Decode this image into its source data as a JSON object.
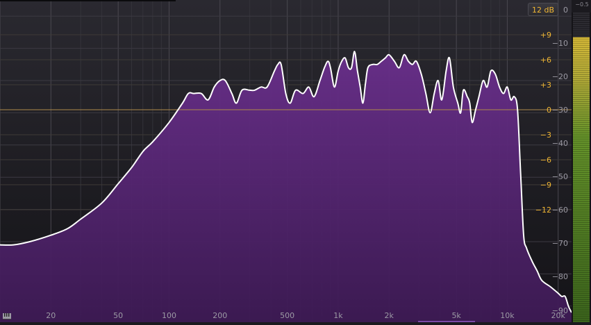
{
  "toolbar": {
    "range_label": "12 dB"
  },
  "meter": {
    "peak_label": "−0.5",
    "level_fraction": 0.92
  },
  "scale": {
    "gain_labels": [
      "+9",
      "+6",
      "+3",
      "0",
      "−3",
      "−6",
      "−9",
      "−12"
    ],
    "db_labels": [
      "0",
      "−10",
      "−20",
      "−30",
      "−40",
      "−50",
      "−60",
      "−70",
      "−80",
      "−90"
    ],
    "freq_labels": [
      "20",
      "50",
      "100",
      "200",
      "500",
      "1k",
      "2k",
      "5k",
      "10k",
      "20k"
    ]
  },
  "colors": {
    "background": "#1b1a1f",
    "spectrum_fill": "#5a2a78",
    "spectrum_line": "#ffffff",
    "zero_line": "#b08a4a",
    "accent_orange": "#f2b733",
    "meter_yellow": "#e0c23a",
    "meter_green": "#5d8a2b"
  },
  "icons": {
    "piano": "piano-keys-icon"
  },
  "spectrum": {
    "points": [
      [
        10,
        -71
      ],
      [
        12,
        -71
      ],
      [
        15,
        -70
      ],
      [
        20,
        -68
      ],
      [
        25,
        -66
      ],
      [
        30,
        -63
      ],
      [
        40,
        -58
      ],
      [
        50,
        -52
      ],
      [
        60,
        -47
      ],
      [
        70,
        -42
      ],
      [
        80,
        -39
      ],
      [
        100,
        -33
      ],
      [
        120,
        -27
      ],
      [
        130,
        -24
      ],
      [
        140,
        -24
      ],
      [
        155,
        -24
      ],
      [
        170,
        -26
      ],
      [
        185,
        -22
      ],
      [
        200,
        -20
      ],
      [
        215,
        -20
      ],
      [
        235,
        -24
      ],
      [
        250,
        -27
      ],
      [
        270,
        -23
      ],
      [
        300,
        -23
      ],
      [
        320,
        -23
      ],
      [
        350,
        -22
      ],
      [
        380,
        -22
      ],
      [
        420,
        -17
      ],
      [
        440,
        -15
      ],
      [
        460,
        -15
      ],
      [
        490,
        -24
      ],
      [
        520,
        -27
      ],
      [
        560,
        -23
      ],
      [
        620,
        -24
      ],
      [
        670,
        -22
      ],
      [
        720,
        -25
      ],
      [
        780,
        -20
      ],
      [
        830,
        -16
      ],
      [
        870,
        -14
      ],
      [
        900,
        -16
      ],
      [
        950,
        -22
      ],
      [
        1000,
        -17
      ],
      [
        1050,
        -14
      ],
      [
        1100,
        -13
      ],
      [
        1150,
        -16
      ],
      [
        1200,
        -16
      ],
      [
        1250,
        -11
      ],
      [
        1300,
        -17
      ],
      [
        1350,
        -22
      ],
      [
        1400,
        -27
      ],
      [
        1450,
        -21
      ],
      [
        1500,
        -16
      ],
      [
        1600,
        -15
      ],
      [
        1700,
        -15
      ],
      [
        1800,
        -14
      ],
      [
        1900,
        -13
      ],
      [
        2000,
        -12
      ],
      [
        2150,
        -14
      ],
      [
        2300,
        -16
      ],
      [
        2450,
        -12
      ],
      [
        2600,
        -14
      ],
      [
        2750,
        -15
      ],
      [
        2900,
        -14
      ],
      [
        3100,
        -18
      ],
      [
        3300,
        -24
      ],
      [
        3500,
        -30
      ],
      [
        3700,
        -24
      ],
      [
        3900,
        -20
      ],
      [
        4100,
        -26
      ],
      [
        4350,
        -17
      ],
      [
        4550,
        -13
      ],
      [
        4800,
        -22
      ],
      [
        5100,
        -27
      ],
      [
        5300,
        -30
      ],
      [
        5500,
        -23
      ],
      [
        5800,
        -25
      ],
      [
        6000,
        -27
      ],
      [
        6200,
        -33
      ],
      [
        6500,
        -29
      ],
      [
        6800,
        -25
      ],
      [
        7200,
        -20
      ],
      [
        7600,
        -22
      ],
      [
        8000,
        -17
      ],
      [
        8500,
        -18
      ],
      [
        9000,
        -22
      ],
      [
        9500,
        -24
      ],
      [
        10000,
        -22
      ],
      [
        10500,
        -26
      ],
      [
        11000,
        -25
      ],
      [
        11500,
        -29
      ],
      [
        12000,
        -49
      ],
      [
        12500,
        -68
      ],
      [
        13000,
        -72
      ],
      [
        14000,
        -76
      ],
      [
        15000,
        -79
      ],
      [
        16000,
        -82
      ],
      [
        18000,
        -84
      ],
      [
        20000,
        -86
      ],
      [
        21000,
        -87
      ],
      [
        22000,
        -87
      ],
      [
        23000,
        -90
      ],
      [
        24000,
        -92
      ]
    ]
  }
}
